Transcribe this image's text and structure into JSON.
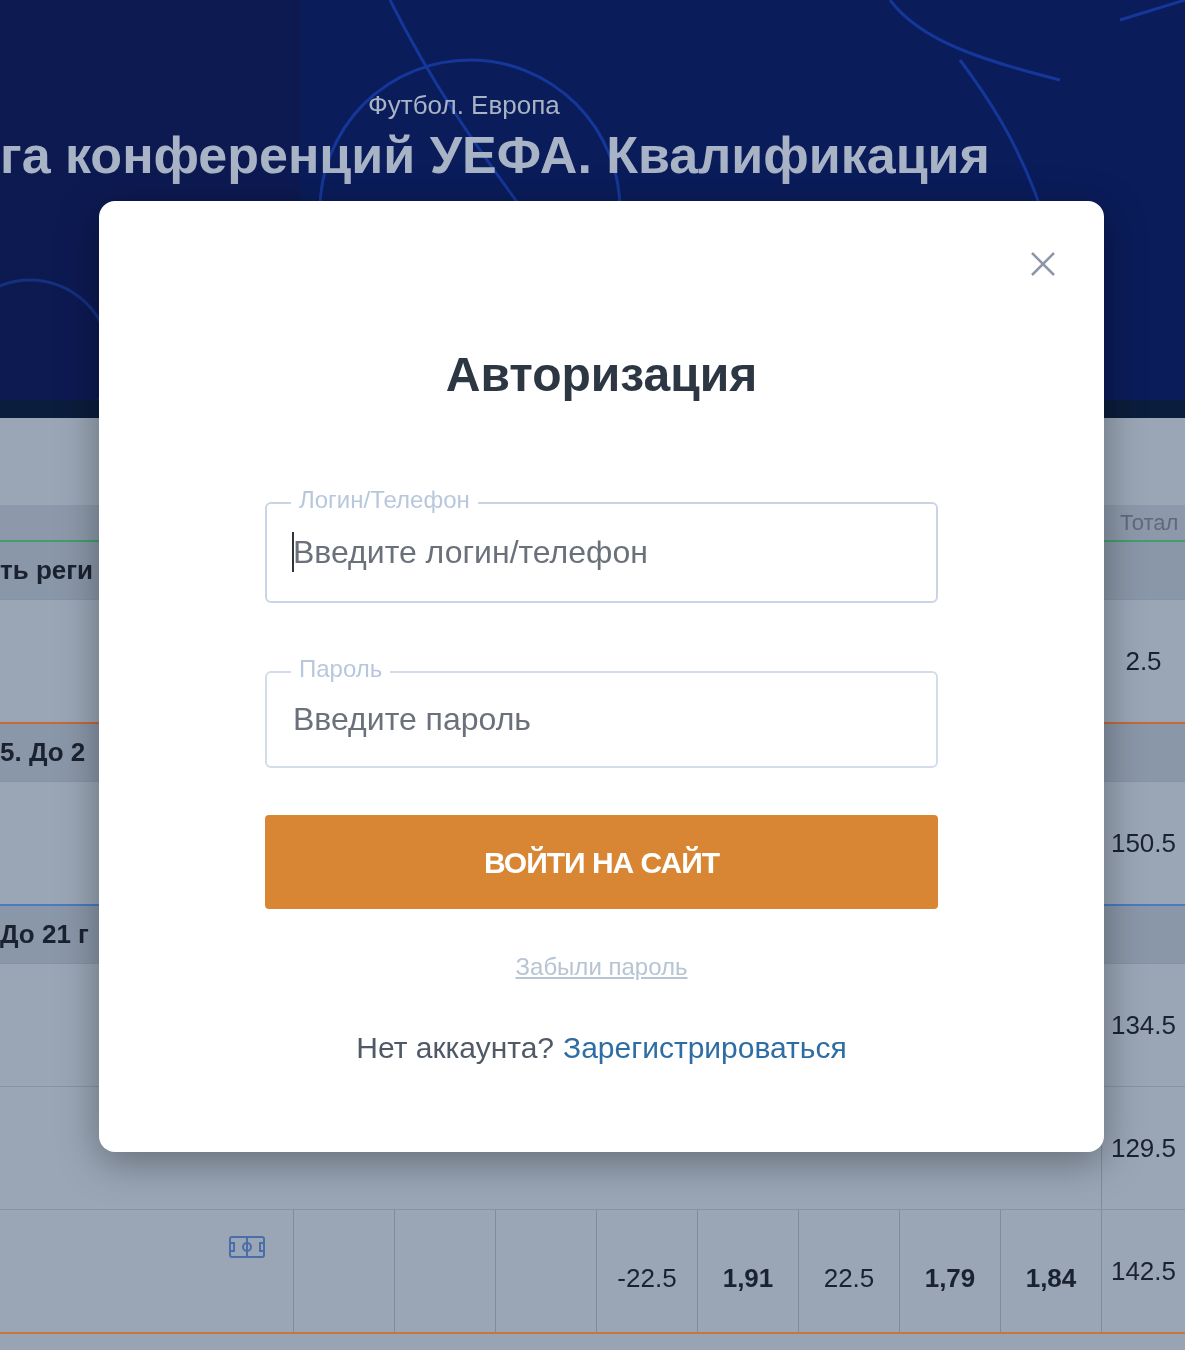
{
  "header": {
    "subtitle": "Футбол. Европа",
    "title": "га конференций УЕФА. Квалификация"
  },
  "table": {
    "rows": [
      {
        "kind": "header",
        "total": "Тотал"
      },
      {
        "kind": "group",
        "label": "ть реги",
        "color": "#3f9f6a"
      },
      {
        "kind": "data",
        "total": "2.5"
      },
      {
        "kind": "group",
        "label": "5. До 2",
        "color": "#c26a3a"
      },
      {
        "kind": "data",
        "total": "150.5"
      },
      {
        "kind": "group",
        "label": "До 21 г",
        "color": "#4a7ac0"
      },
      {
        "kind": "data",
        "total": "134.5"
      },
      {
        "kind": "data",
        "total": "129.5"
      },
      {
        "kind": "match",
        "cells": [
          {
            "text": "-22.5",
            "bold": false
          },
          {
            "text": "1,91",
            "bold": true
          },
          {
            "text": "22.5",
            "bold": false
          },
          {
            "text": "1,79",
            "bold": true
          },
          {
            "text": "1,84",
            "bold": true
          }
        ],
        "total": "142.5"
      },
      {
        "kind": "divider",
        "color": "#c8773a"
      }
    ]
  },
  "modal": {
    "title": "Авторизация",
    "fields": [
      {
        "label": "Логин/Телефон",
        "placeholder": "Введите логин/телефон",
        "focused": true
      },
      {
        "label": "Пароль",
        "placeholder": "Введите пароль",
        "focused": false
      }
    ],
    "submit": "ВОЙТИ НА САЙТ",
    "forgot": "Забыли пароль",
    "no_account": "Нет аккаунта?",
    "register": "Зарегистрироваться"
  }
}
